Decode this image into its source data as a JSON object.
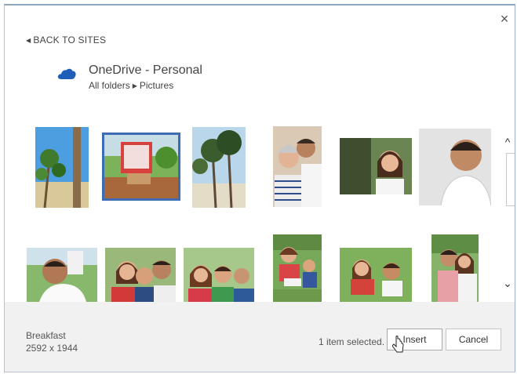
{
  "dialog": {
    "close_label": "×",
    "back_label": "BACK TO SITES",
    "location": {
      "title": "OneDrive - Personal",
      "breadcrumb": [
        "All folders",
        "Pictures"
      ]
    }
  },
  "gallery": {
    "selected_index": 1,
    "items": [
      {
        "name": "beach-trees-tall"
      },
      {
        "name": "beach-chair-deck"
      },
      {
        "name": "palm-trees-beach"
      },
      {
        "name": "couple-senior"
      },
      {
        "name": "woman-portrait"
      },
      {
        "name": "man-smiling"
      },
      {
        "name": "man-golf"
      },
      {
        "name": "family-three"
      },
      {
        "name": "family-kids"
      },
      {
        "name": "woman-reading-kids"
      },
      {
        "name": "mother-child-grass"
      },
      {
        "name": "couple-outdoor"
      }
    ]
  },
  "footer": {
    "file_name": "Breakfast",
    "file_dims": "2592 x 1944",
    "status": "1 item selected.",
    "insert_label": "Insert",
    "cancel_label": "Cancel"
  },
  "colors": {
    "accent": "#3d6bb4",
    "onedrive": "#1e5fb8",
    "footer_bg": "#f1f1f1"
  },
  "icons": {
    "close": "close-icon",
    "back": "chevron-left-icon",
    "cloud": "onedrive-cloud-icon",
    "scroll_up": "chevron-up-icon",
    "scroll_down": "chevron-down-icon"
  }
}
